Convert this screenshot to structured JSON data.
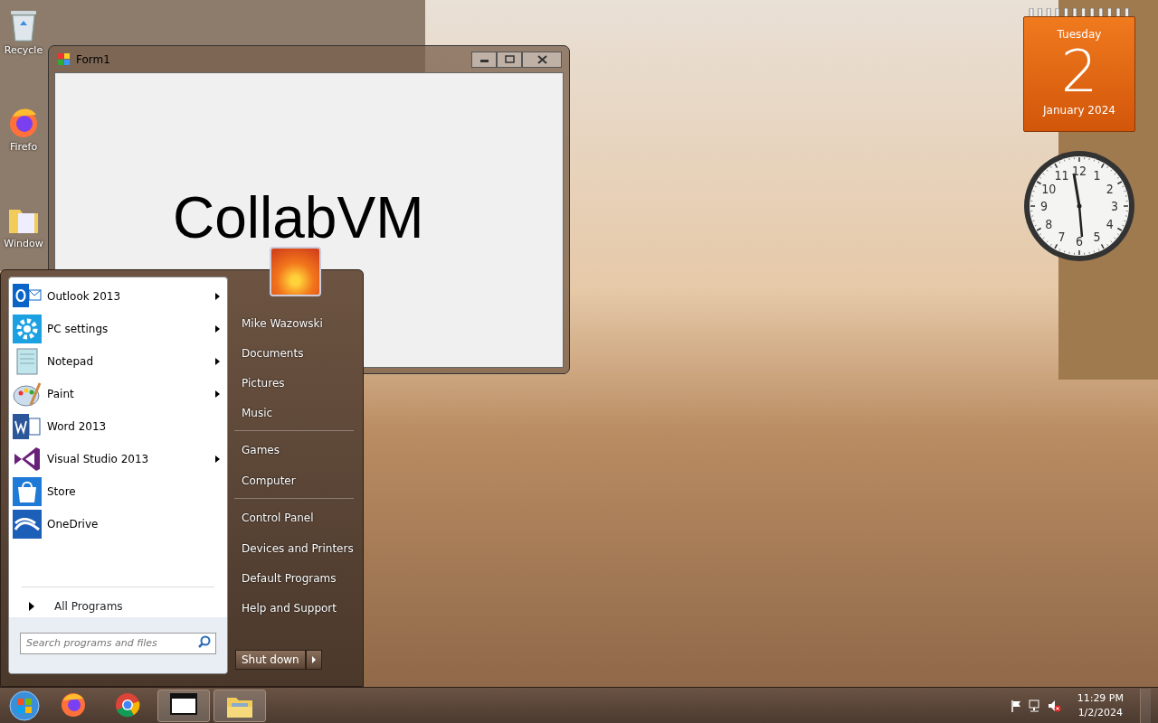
{
  "desktop_icons": [
    {
      "label": "Recycle"
    },
    {
      "label": "Firefo"
    },
    {
      "label": "Window"
    }
  ],
  "window": {
    "title": "Form1",
    "content": "CollabVM"
  },
  "calendar_gadget": {
    "weekday": "Tuesday",
    "day": "2",
    "month_year": "January 2024"
  },
  "clock_gadget": {
    "numerals": [
      "12",
      "11",
      "1",
      "10",
      "2",
      "9",
      "3",
      "8",
      "4",
      "7",
      "5",
      "6"
    ]
  },
  "start_menu": {
    "programs": [
      {
        "label": "Outlook 2013",
        "has_submenu": true
      },
      {
        "label": "PC settings",
        "has_submenu": true
      },
      {
        "label": "Notepad",
        "has_submenu": true
      },
      {
        "label": "Paint",
        "has_submenu": true
      },
      {
        "label": "Word 2013",
        "has_submenu": false
      },
      {
        "label": "Visual Studio 2013",
        "has_submenu": true
      },
      {
        "label": "Store",
        "has_submenu": false
      },
      {
        "label": "OneDrive",
        "has_submenu": false
      }
    ],
    "all_programs": "All Programs",
    "search": {
      "placeholder": "Search programs and files"
    },
    "places": [
      {
        "label": "Mike Wazowski",
        "separator_before": false
      },
      {
        "label": "Documents",
        "separator_before": false
      },
      {
        "label": "Pictures",
        "separator_before": false
      },
      {
        "label": "Music",
        "separator_before": false
      },
      {
        "label": "Games",
        "separator_before": true
      },
      {
        "label": "Computer",
        "separator_before": false
      },
      {
        "label": "Control Panel",
        "separator_before": true
      },
      {
        "label": "Devices and Printers",
        "separator_before": false
      },
      {
        "label": "Default Programs",
        "separator_before": false
      },
      {
        "label": "Help and Support",
        "separator_before": false
      }
    ],
    "shutdown": "Shut down"
  },
  "taskbar": {
    "items": [
      {
        "running": false
      },
      {
        "running": false
      },
      {
        "running": true
      },
      {
        "running": true
      }
    ],
    "time": "11:29 PM",
    "date": "1/2/2024"
  }
}
